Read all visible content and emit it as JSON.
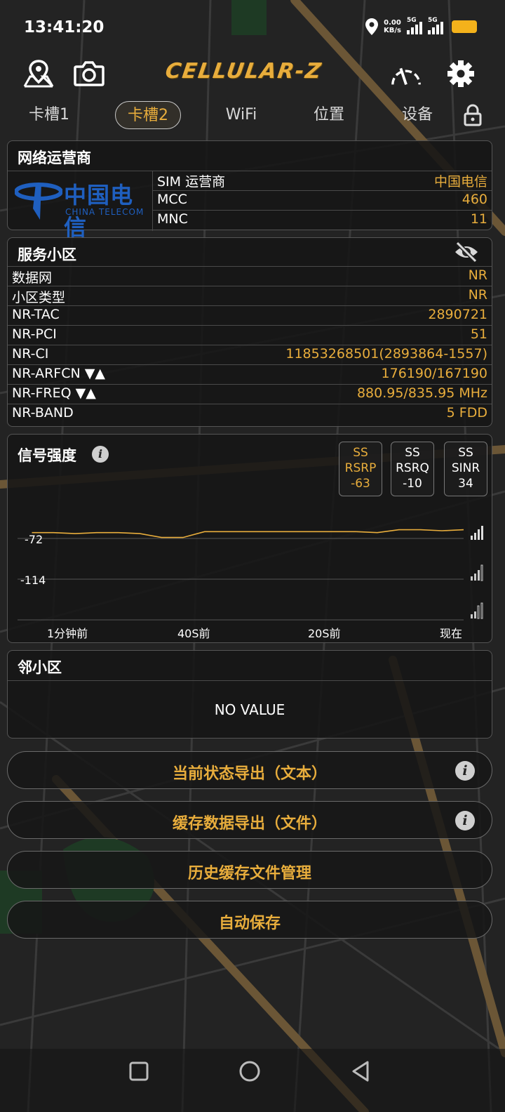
{
  "status": {
    "time": "13:41:20",
    "net_speed_value": "0.00",
    "net_speed_unit": "KB/s",
    "sim1_label": "5G",
    "sim2_label": "5G"
  },
  "app": {
    "logo": "CELLULAR-Z"
  },
  "tabs": [
    {
      "label": "卡槽1",
      "active": false
    },
    {
      "label": "卡槽2",
      "active": true
    },
    {
      "label": "WiFi",
      "active": false
    },
    {
      "label": "位置",
      "active": false
    },
    {
      "label": "设备",
      "active": false
    }
  ],
  "operator": {
    "title": "网络运营商",
    "logo_cn": "中国电信",
    "logo_en": "CHINA TELECOM",
    "rows": [
      {
        "key": "SIM 运营商",
        "value": "中国电信"
      },
      {
        "key": "MCC",
        "value": "460"
      },
      {
        "key": "MNC",
        "value": "11"
      }
    ]
  },
  "serving_cell": {
    "title": "服务小区",
    "rows": [
      {
        "key": "数据网",
        "value": "NR"
      },
      {
        "key": "小区类型",
        "value": "NR"
      },
      {
        "key": "NR-TAC",
        "value": "2890721"
      },
      {
        "key": "NR-PCI",
        "value": "51"
      },
      {
        "key": "NR-CI",
        "value": "11853268501(2893864-1557)"
      },
      {
        "key": "NR-ARFCN ▼▲",
        "value": "176190/167190"
      },
      {
        "key": "NR-FREQ ▼▲",
        "value": "880.95/835.95 MHz"
      },
      {
        "key": "NR-BAND",
        "value": "5 FDD"
      }
    ]
  },
  "signal": {
    "title": "信号强度",
    "metrics": [
      {
        "line1": "SS",
        "line2": "RSRP",
        "value": "-63",
        "active": true
      },
      {
        "line1": "SS",
        "line2": "RSRQ",
        "value": "-10",
        "active": false
      },
      {
        "line1": "SS",
        "line2": "SINR",
        "value": "34",
        "active": false
      }
    ],
    "y_labels": [
      "-72",
      "-114"
    ],
    "x_labels": [
      "1分钟前",
      "40S前",
      "20S前",
      "现在"
    ],
    "line_color": "#e8ad3c"
  },
  "chart_data": {
    "type": "line",
    "title": "信号强度",
    "x": [
      -60,
      -57,
      -54,
      -51,
      -48,
      -45,
      -42,
      -39,
      -36,
      -33,
      -30,
      -27,
      -24,
      -21,
      -18,
      -15,
      -12,
      -9,
      -6,
      -3,
      0
    ],
    "series": [
      {
        "values": [
          -66,
          -66,
          -67,
          -66,
          -66,
          -67,
          -71,
          -71,
          -65,
          -65,
          -65,
          -65,
          -65,
          -65,
          -65,
          -65,
          -66,
          -63,
          -63,
          -64,
          -63
        ]
      }
    ],
    "y_ticks": [
      -72,
      -114
    ],
    "x_tick_labels": [
      "1分钟前",
      "40S前",
      "20S前",
      "现在"
    ],
    "ylim": [
      -140,
      -55
    ],
    "grid": true
  },
  "neighbor": {
    "title": "邻小区",
    "empty_text": "NO VALUE"
  },
  "buttons": [
    {
      "label": "当前状态导出（文本）",
      "info": true
    },
    {
      "label": "缓存数据导出（文件）",
      "info": true
    },
    {
      "label": "历史缓存文件管理",
      "info": false
    },
    {
      "label": "自动保存",
      "info": false
    }
  ],
  "colors": {
    "accent": "#e8ad3c",
    "battery": "#f4b21b",
    "telecom_blue": "#1f5fbf"
  }
}
